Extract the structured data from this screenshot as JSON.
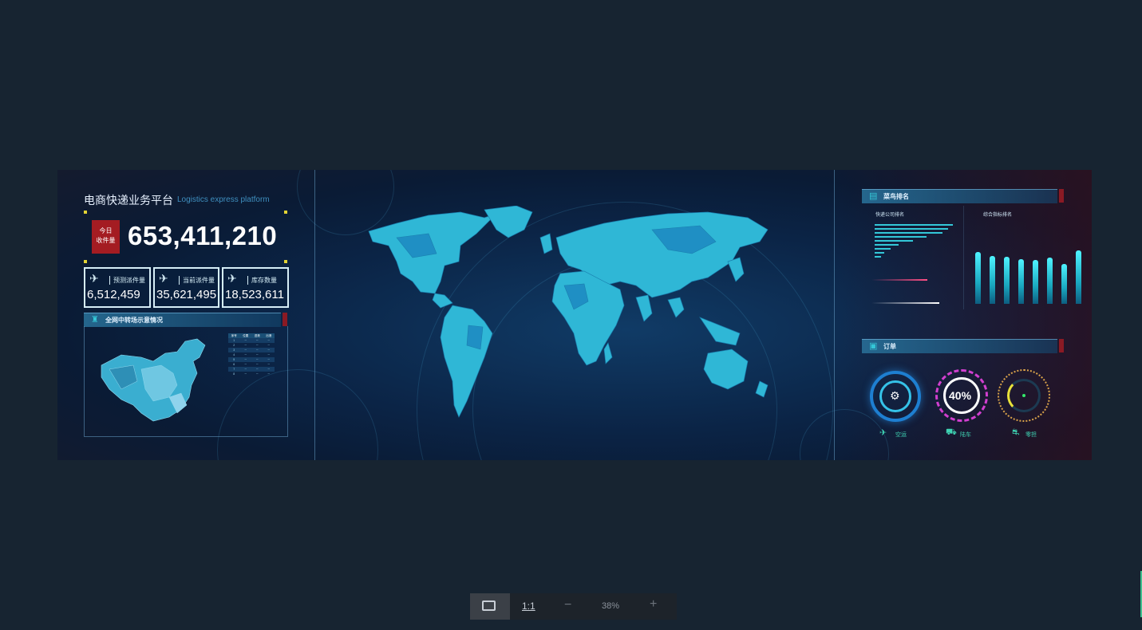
{
  "dashboard": {
    "title": "电商快递业务平台",
    "subtitle": "Logistics express platform",
    "today": {
      "badge_line1": "今日",
      "badge_line2": "收件量",
      "value": "653,411,210"
    },
    "kpis": [
      {
        "icon": "airplane-icon",
        "label": "预测派件量",
        "value": "6,512,459"
      },
      {
        "icon": "airplane-icon",
        "label": "当前派件量",
        "value": "35,621,495"
      },
      {
        "icon": "airplane-icon",
        "label": "库存数量",
        "value": "18,523,611"
      }
    ],
    "transit_panel": {
      "title": "全网中转场示意情况"
    },
    "ranking_panel": {
      "title": "菜鸟排名",
      "left_chart": "快递公司排名",
      "right_chart": "综合指标排名"
    },
    "order_panel": {
      "title": "订单",
      "gauges": [
        {
          "label": "空运",
          "icon": "airplane-icon"
        },
        {
          "label": "陆车",
          "icon": "truck-icon",
          "value": "40%"
        },
        {
          "label": "零担",
          "icon": "motorcycle-icon"
        }
      ]
    },
    "right_bars": [
      0.93,
      0.85,
      0.84,
      0.8,
      0.79,
      0.83,
      0.72,
      0.95
    ],
    "ranking_hbars": [
      0.98,
      0.92,
      0.85,
      0.65,
      0.48,
      0.3,
      0.2,
      0.12,
      0.08
    ]
  },
  "zoom_toolbar": {
    "fit_icon": "fit-screen-icon",
    "actual_size": "1:1",
    "minus": "−",
    "zoom": "38%",
    "plus": "+"
  },
  "colors": {
    "page_bg": "#172431",
    "accent": "#33c7d8",
    "badge_red": "#a41c22",
    "map_fill": "#2fb7d6"
  }
}
